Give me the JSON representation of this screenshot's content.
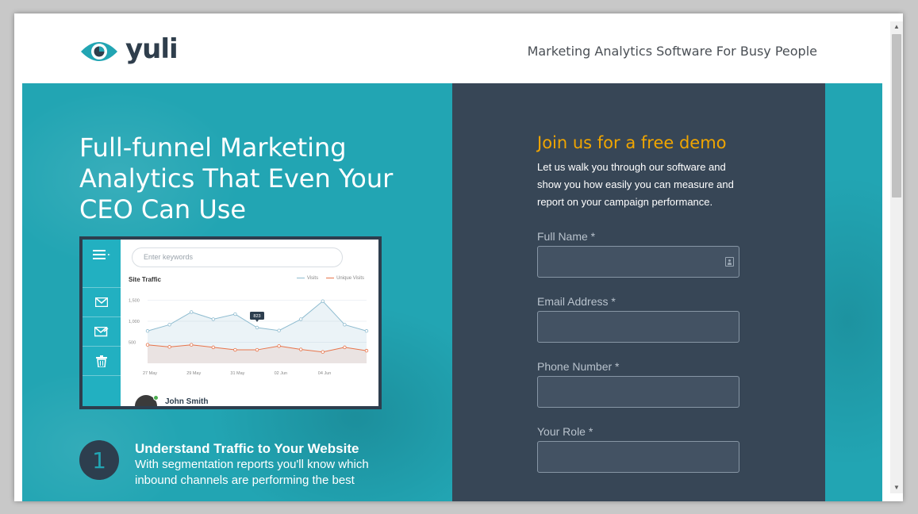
{
  "brand": {
    "name": "yuli",
    "tagline": "Marketing Analytics Software For Busy People",
    "accent": "#22a5b3",
    "dark": "#2f3e4c"
  },
  "hero": {
    "headline": "Full-funnel Marketing Analytics That Even Your CEO Can Use",
    "mockup": {
      "search_placeholder": "Enter keywords",
      "chart_title": "Site Traffic",
      "legend": [
        "Visits",
        "Unique Visits"
      ],
      "tooltip": "823",
      "user_name": "John Smith",
      "chart_data": {
        "type": "line",
        "title": "Site Traffic",
        "x": [
          "27 May",
          "29 May",
          "31 May",
          "02 Jun",
          "04 Jun"
        ],
        "x_points": 11,
        "yticks": [
          "1,500",
          "1,000",
          "500"
        ],
        "ylim": [
          0,
          1700
        ],
        "series": [
          {
            "name": "Visits",
            "color": "#8fbcd0",
            "values": [
              770,
              920,
              1220,
              1050,
              1170,
              850,
              780,
              1050,
              1480,
              920,
              770
            ]
          },
          {
            "name": "Unique Visits",
            "color": "#e8744a",
            "values": [
              440,
              390,
              440,
              380,
              320,
              320,
              410,
              330,
              270,
              380,
              300
            ]
          }
        ]
      }
    },
    "feature": {
      "number": "1",
      "title": "Understand Traffic to Your Website",
      "description": "With segmentation reports you'll know which inbound channels are performing the best"
    }
  },
  "form": {
    "title": "Join us for a free demo",
    "subtitle": "Let us walk you through our software and show you how easily you can measure and report on your campaign performance.",
    "fields": [
      {
        "label": "Full Name *",
        "value": ""
      },
      {
        "label": "Email Address *",
        "value": ""
      },
      {
        "label": "Phone Number *",
        "value": ""
      },
      {
        "label": "Your Role *",
        "value": ""
      }
    ]
  }
}
